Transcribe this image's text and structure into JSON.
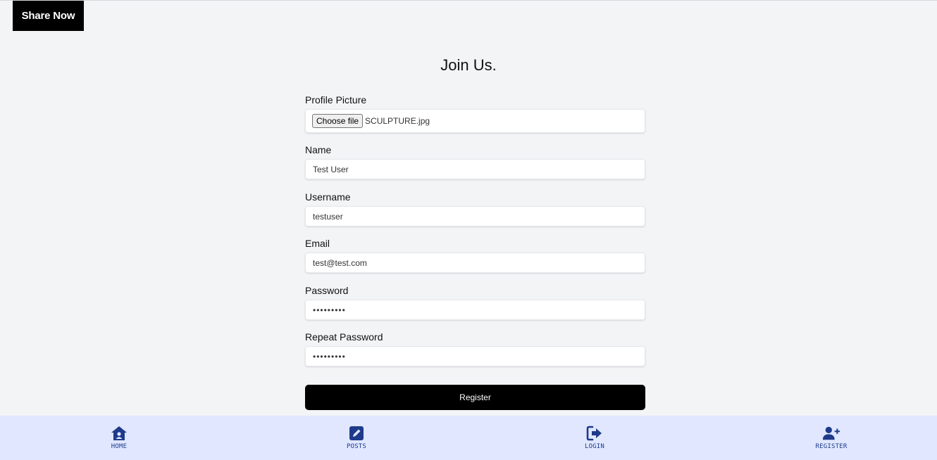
{
  "header": {
    "brand": "Share Now"
  },
  "page": {
    "title": "Join Us."
  },
  "form": {
    "profile_picture": {
      "label": "Profile Picture",
      "button": "Choose file",
      "file_name": "SCULPTURE.jpg"
    },
    "name": {
      "label": "Name",
      "value": "Test User"
    },
    "username": {
      "label": "Username",
      "value": "testuser"
    },
    "email": {
      "label": "Email",
      "value": "test@test.com"
    },
    "password": {
      "label": "Password",
      "value": "•••••••••"
    },
    "repeat_password": {
      "label": "Repeat Password",
      "value": "•••••••••"
    },
    "submit": "Register"
  },
  "bottom_nav": {
    "items": [
      {
        "label": "HOME",
        "icon": "home-icon"
      },
      {
        "label": "POSTS",
        "icon": "edit-icon"
      },
      {
        "label": "LOGIN",
        "icon": "login-icon"
      },
      {
        "label": "REGISTER",
        "icon": "user-plus-icon"
      }
    ]
  },
  "colors": {
    "accent": "#1e3a8a",
    "nav_bg": "#e0e7ff",
    "page_bg": "#f3f4f6",
    "brand_bg": "#000000"
  }
}
